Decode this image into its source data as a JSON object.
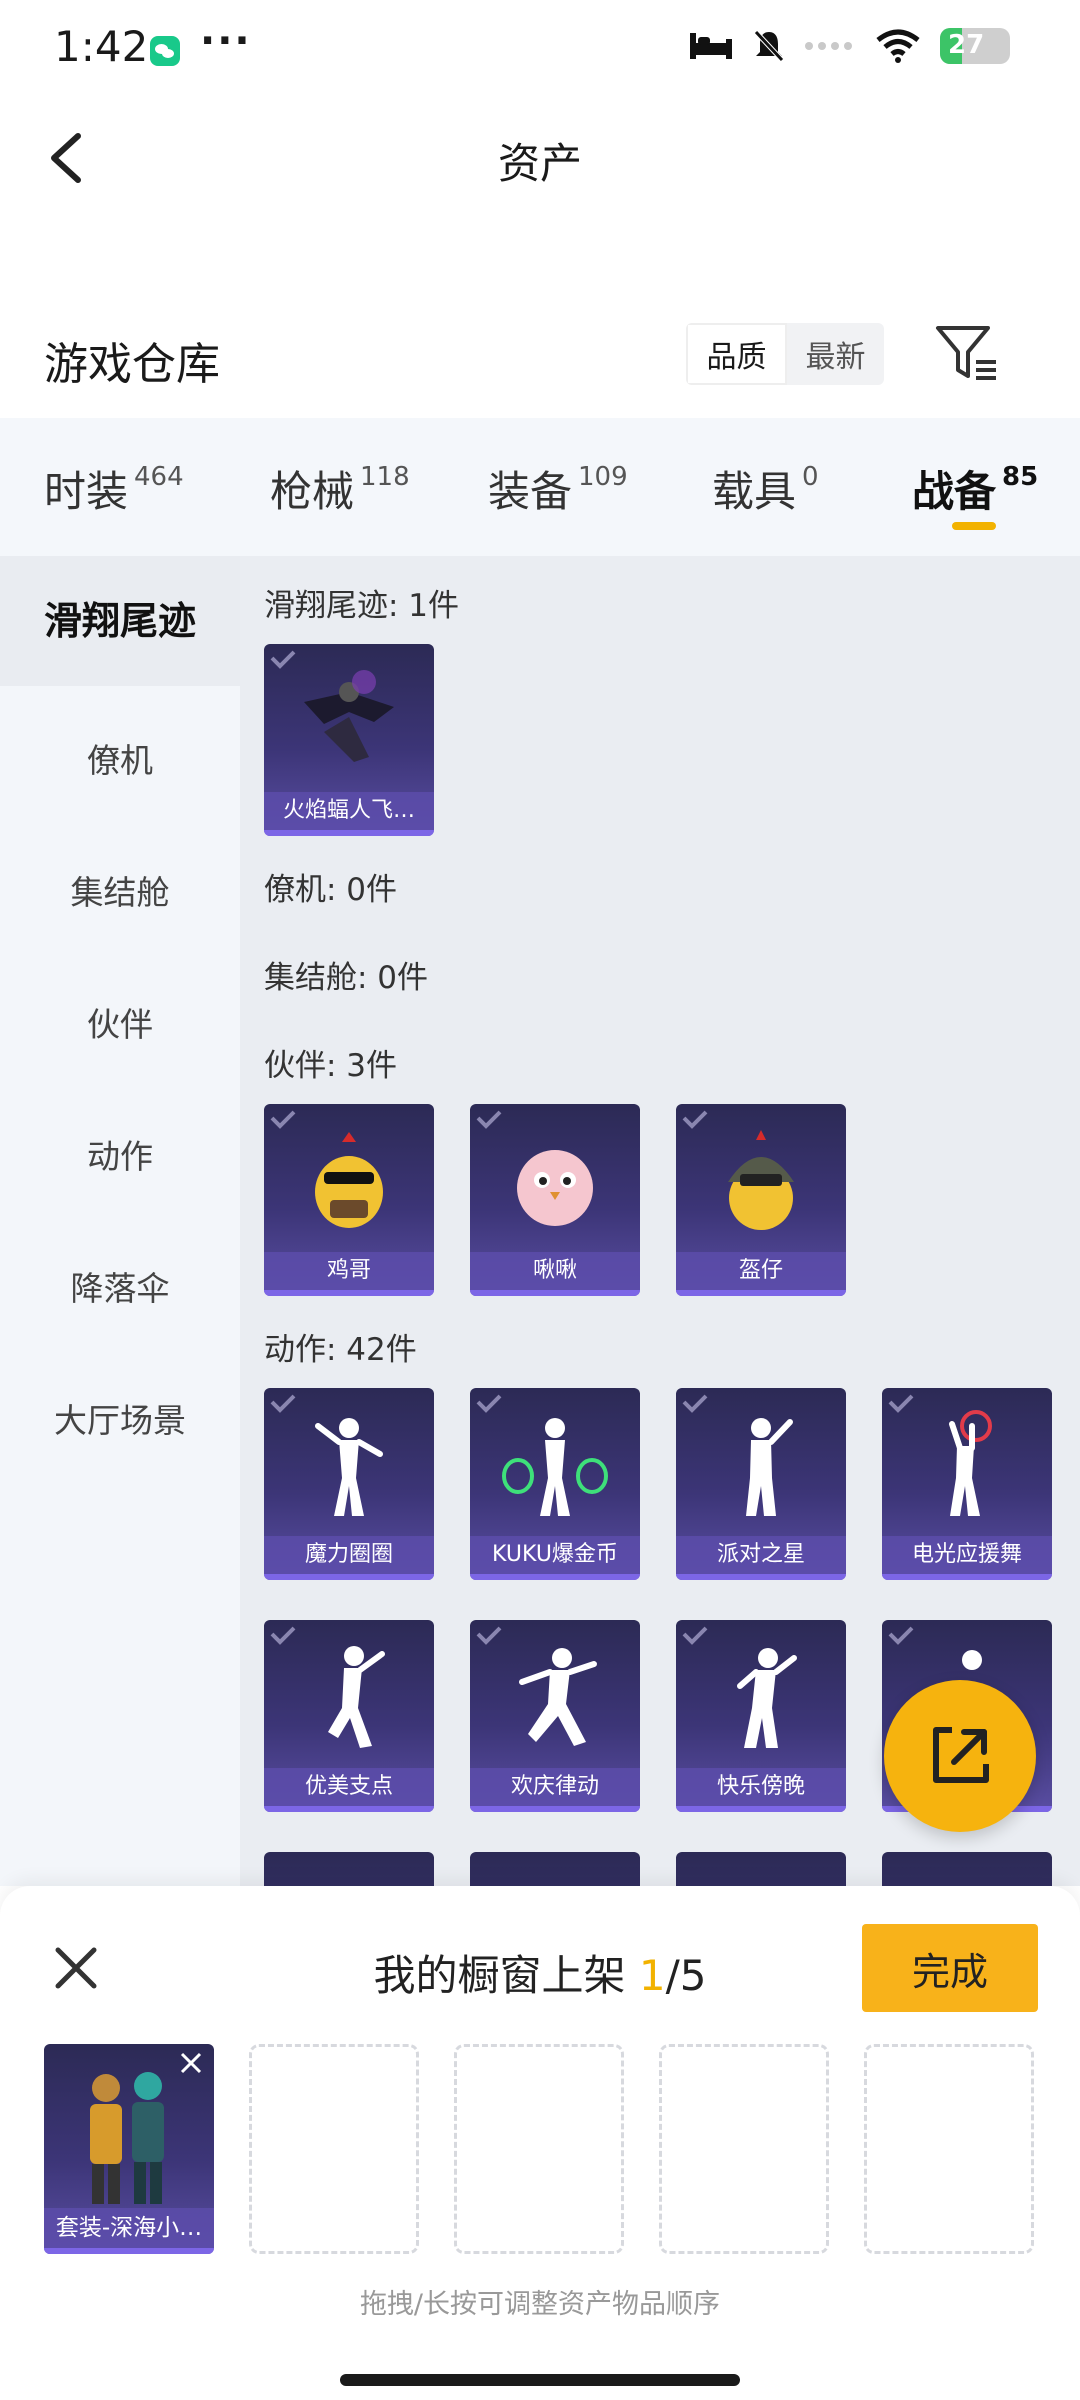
{
  "status_bar": {
    "time": "1:42",
    "more": "···",
    "battery": "27"
  },
  "header": {
    "title": "资产"
  },
  "warehouse": {
    "title": "游戏仓库",
    "sort_options": [
      "品质",
      "最新"
    ],
    "selected_sort": "品质"
  },
  "tabs": [
    {
      "label": "时装",
      "count": "464"
    },
    {
      "label": "枪械",
      "count": "118"
    },
    {
      "label": "装备",
      "count": "109"
    },
    {
      "label": "载具",
      "count": "0"
    },
    {
      "label": "战备",
      "count": "85"
    }
  ],
  "active_tab": "战备",
  "sidebar": {
    "items": [
      "滑翔尾迹",
      "僚机",
      "集结舱",
      "伙伴",
      "动作",
      "降落伞",
      "大厅场景"
    ],
    "active": "滑翔尾迹"
  },
  "sections": [
    {
      "heading": "滑翔尾迹: 1件",
      "items": [
        "火焰蝠人飞…"
      ]
    },
    {
      "heading": "僚机: 0件",
      "items": []
    },
    {
      "heading": "集结舱: 0件",
      "items": []
    },
    {
      "heading": "伙伴: 3件",
      "items": [
        "鸡哥",
        "啾啾",
        "盔仔"
      ]
    },
    {
      "heading": "动作: 42件",
      "items": [
        "魔力圈圈",
        "KUKU爆金币",
        "派对之星",
        "电光应援舞",
        "优美支点",
        "欢庆律动",
        "快乐傍晚"
      ]
    }
  ],
  "showcase": {
    "title_prefix": "我的橱窗上架 ",
    "current": "1",
    "total": "/5",
    "done_label": "完成",
    "slots": [
      "套装-深海小…",
      "",
      "",
      "",
      ""
    ],
    "hint": "拖拽/长按可调整资产物品顺序"
  },
  "colors": {
    "accent": "#f2b200",
    "card_bg": "#3c3577",
    "card_label": "#5c4caa"
  }
}
